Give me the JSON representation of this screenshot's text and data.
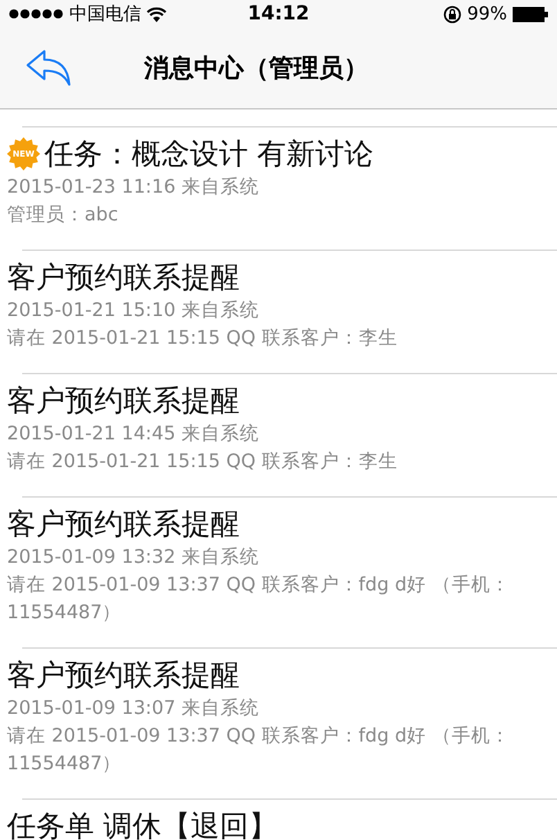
{
  "status_bar": {
    "carrier": "中国电信",
    "time": "14:12",
    "battery": "99%"
  },
  "nav": {
    "title": "消息中心（管理员）"
  },
  "messages": [
    {
      "title": "任务：概念设计 有新讨论",
      "badge": "NEW",
      "meta": "2015-01-23 11:16 来自系统",
      "body": "管理员：abc"
    },
    {
      "title": "客户预约联系提醒",
      "meta": "2015-01-21 15:10 来自系统",
      "body": "请在 2015-01-21 15:15 QQ 联系客户：李生"
    },
    {
      "title": "客户预约联系提醒",
      "meta": "2015-01-21 14:45 来自系统",
      "body": "请在 2015-01-21 15:15 QQ 联系客户：李生"
    },
    {
      "title": "客户预约联系提醒",
      "meta": "2015-01-09 13:32 来自系统",
      "body": "请在 2015-01-09 13:37 QQ 联系客户：fdg d好 （手机：11554487）"
    },
    {
      "title": "客户预约联系提醒",
      "meta": "2015-01-09 13:07 来自系统",
      "body": "请在 2015-01-09 13:37 QQ 联系客户：fdg d好 （手机：11554487）"
    },
    {
      "title": "任务单 调休【退回】"
    }
  ]
}
